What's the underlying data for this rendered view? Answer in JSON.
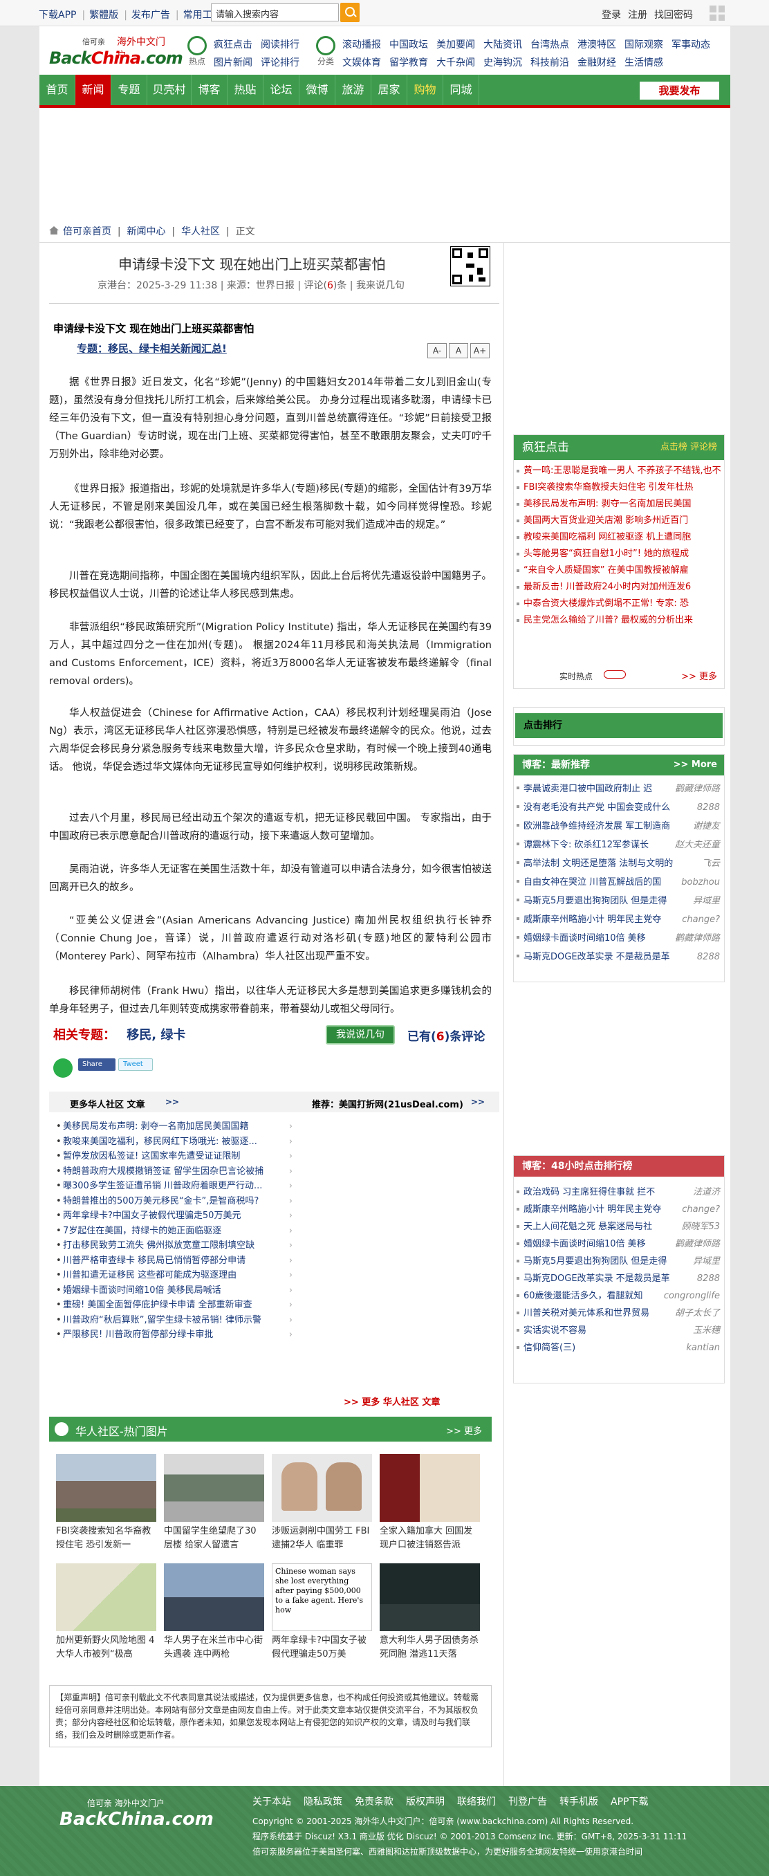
{
  "topbar": {
    "download": "下载APP",
    "trad": "繁體版",
    "ad": "发布广告",
    "tools": "常用工具",
    "search_placeholder": "请输入搜索内容",
    "login": "登录",
    "register": "注册",
    "forgot": "找回密码"
  },
  "logo": {
    "small": "倍可亲",
    "red": "海外中文门户",
    "big_pre": "Back",
    "big_mid": "China",
    "big_post": ".com"
  },
  "nav_hot": {
    "label": "热点",
    "row1": [
      "疯狂点击",
      "阅读排行"
    ],
    "row2": [
      "图片新闻",
      "评论排行"
    ]
  },
  "nav_cat": {
    "label": "分类",
    "row1": [
      "滚动播报",
      "中国政坛",
      "美加要闻",
      "大陆资讯",
      "台湾热点",
      "港澳特区",
      "国际观察",
      "军事动态"
    ],
    "row2": [
      "文娱体育",
      "留学教育",
      "大千杂闻",
      "史海钩沉",
      "科技前沿",
      "金融财经",
      "生活情感"
    ]
  },
  "mainnav": [
    "首页",
    "新闻",
    "专题",
    "贝壳村",
    "博客",
    "热贴",
    "论坛",
    "微博",
    "旅游",
    "居家",
    "购物",
    "同城"
  ],
  "publish": "我要发布",
  "crumb": [
    "倍可亲首页",
    "新闻中心",
    "华人社区",
    "正文"
  ],
  "article": {
    "title": "申请绿卡没下文 现在她出门上班买菜都害怕",
    "meta_source": "京港台：2025-3-29 11:38 | 来源：世界日报 | 评论(",
    "meta_count": "6",
    "meta_tail": ")条 | 我来说几句",
    "bold_title": "申请绿卡没下文 现在她出门上班买菜都害怕",
    "topic": "专题：移民、绿卡相关新闻汇总!",
    "font_btns": [
      "A-",
      "A",
      "A+"
    ],
    "paras": [
      "据《世界日报》近日发文，化名“珍妮”(Jenny) 的中国籍妇女2014年带着二女儿到旧金山(专题)，虽然没有身分但找托儿所打工机会，后来嫁给美公民。 办身分过程出现诸多耽溺，申请绿卡已经三年仍没有下文，但一直没有特别担心身分问题，直到川普总统赢得连任。“珍妮”日前接受卫报（The Guardian）专访时说，现在出门上班、买菜都觉得害怕，甚至不敢跟朋友聚会，丈夫叮咛千万别外出，除非绝对必要。",
      "《世界日报》报道指出，珍妮的处境就是许多华人(专题)移民(专题)的缩影，全国估计有39万华人无证移民，不管是刚来美国没几年，或在美国已经生根落脚数十载，如今同样觉得惶恐。珍妮说：“我跟老公都很害怕，很多政策已经变了，白宫不断发布可能对我们造成冲击的规定。”",
      "川普在竞选期间指称，中国企图在美国境内组织军队，因此上台后将优先遣返役龄中国籍男子。 移民权益倡议人士说，川普的论述让华人移民感到焦虑。",
      "非营派组织“移民政策研究所”(Migration Policy Institute) 指出，华人无证移民在美国约有39万人，其中超过四分之一住在加州(专题)。 根据2024年11月移民和海关执法局（Immigration and Customs Enforcement，ICE）资料，将近3万8000名华人无证客被发布最终递解令（final removal orders)。",
      "华人权益促进会（Chinese for Affirmative Action，CAA）移民权利计划经理吴雨泊（Jose Ng）表示，湾区无证移民华人社区弥漫恐惧感，特别是已经被发布最终递解令的民众。他说，过去六周华促会移民身分紧急服务专线来电数量大增，许多民众仓皇求助，有时候一个晚上接到40通电话。 他说，华促会透过华文媒体向无证移民宣导如何维护权利，说明移民政策新规。",
      "过去八个月里，移民局已经出动五个架次的遣返专机，把无证移民载回中国。 专家指出，由于中国政府已表示愿意配合川普政府的遣返行动，接下来遣返人数可望增加。",
      "吴雨泊说，许多华人无证客在美国生活数十年，却没有管道可以申请合法身分，如今很害怕被送回离开已久的故乡。",
      "“亚美公义促进会”(Asian Americans Advancing Justice) 南加州民权组织执行长钟乔（Connie Chung Joe，音译）说，川普政府遣返行动对洛杉矶(专题)地区的蒙特利公园市（Monterey Park）、阿罕布拉市（Alhambra）华人社区出现严重不安。",
      "移民律师胡树伟（Frank Hwu）指出，以往华人无证移民大多是想到美国追求更多赚钱机会的单身年轻男子，但过去几年则转变成携家带眷前来，带着婴幼儿或祖父母同行。"
    ],
    "related_label": "相关专题：",
    "related_links": [
      "移民",
      "绿卡"
    ],
    "say_btn": "我说说几句",
    "comment_pre": "已有(",
    "comment_count": "6",
    "comment_post": ")条评论",
    "share": {
      "wechat": "微信",
      "fb": "Share",
      "tw": "Tweet"
    }
  },
  "more_section": {
    "left_title": "更多华人社区 文章",
    "right_title": "推荐：美国打折网(21usDeal.com)",
    "items": [
      "美移民局发布声明: 剥夺一名南加居民美国国籍",
      "教唆来美国吃福利，移民网红下场哦光: 被驱逐...",
      "暂停发放因私签证! 这国家率先遭受证证限制",
      "特朗普政府大规模撤销签证 留学生因杂巴言论被捕",
      "曝300多学生签证遭吊销 川普政府着眼更严行动...",
      "特朗普推出的500万美元移民“金卡”,是智商税吗?",
      "两年拿绿卡?中国女子被假代理骗走50万美元",
      "7岁起住在美国，持绿卡的她正面临驱逐",
      "打击移民致劳工流失 佛州拟放宽童工限制填空缺",
      "川普严格审查绿卡 移民局已悄悄暂停部分申请",
      "川普扣遣无证移民 这些都可能成为驱逐理由",
      "婚姻绿卡面谈时间缩10倍 美移民局喊话",
      "重磅! 美国全面暂停庇护绿卡申请 全部重新审查",
      "川普政府“秋后算账”,留学生绿卡被吊销! 律师示警",
      "严限移民! 川普政府暂停部分绿卡审批"
    ],
    "more_link": ">> 更多 华人社区 文章"
  },
  "photos": {
    "title": "华人社区-热门图片",
    "more": ">> 更多",
    "items": [
      {
        "cap": "FBI突袭搜索知名华裔教授住宅 恐引发新一"
      },
      {
        "cap": "中国留学生绝望爬了30层楼 给家人留遗言"
      },
      {
        "cap": "涉贩运剥削中国劳工 FBI逮捕2华人 临重罪"
      },
      {
        "cap": "全家入籍加拿大 回国发现户口被注销怒告派"
      },
      {
        "cap": "加州更新野火风险地图 4大华人市被列“极高"
      },
      {
        "cap": "华人男子在米兰市中心街头遇袭 连中两枪"
      },
      {
        "cap": "两年拿绿卡?中国女子被假代理骗走50万美"
      },
      {
        "cap": "意大利华人男子因债务杀死同胞 潜逃11天落"
      }
    ],
    "img3_text": "Chinese woman says she lost everything after paying $500,000 to a fake agent. Here's how"
  },
  "disclaimer": "【郑重声明】倍可亲刊载此文不代表同意其说法或描述，仅为提供更多信息，也不构成任何投资或其他建议。转载需经倍可亲同意并注明出处。本网站有部分文章是由网友自由上传。对于此类文章本站仅提供交流平台，不为其版权负责；部分内容经社区和论坛转载，原作者未知，如果您发现本网站上有侵犯您的知识产权的文章，请及时与我们联络，我们会及时删除或更新作者。",
  "sidebar_hot": {
    "title": "疯狂点击",
    "tabs": [
      "点击榜",
      "评论榜"
    ],
    "items": [
      "黄一鸣:王思聪是我唯一男人 不养孩子不结钱,也不",
      "FBI突袭搜索华裔教授夫妇住宅 引发年杜热",
      "美移民局发布声明: 剥夺一名南加居民美国",
      "美国两大百货业迎关店潮 影响多州近百门",
      "教唆来美国吃福利 网红被驱逐 机上遭同胞",
      "头等舱男客“疯狂自慰1小时”! 她的旅程成",
      "“来自令人质疑国家” 在美中国教授被解雇",
      "最新反击! 川普政府24小时内对加州连发6",
      "中泰合资大楼爆炸式倒塌不正常! 专家: 恐",
      "民主党怎么输给了川普? 最权威的分析出来"
    ],
    "realtime": "实时热点",
    "more": ">> 更多"
  },
  "sidebar_rank": {
    "title": "点击排行"
  },
  "sidebar_blog": {
    "title": "博客：最新推荐",
    "more": ">> More",
    "items": [
      {
        "t": "李晨诚卖港口被中国政府制止 迟",
        "a": "鹳藏律师路"
      },
      {
        "t": "没有老毛没有共产党 中国会变成什么",
        "a": "8288"
      },
      {
        "t": "欧洲靠战争维持经济发展 军工制造商",
        "a": "谢捷友"
      },
      {
        "t": "谭震林下令: 砍杀红12军参谋长",
        "a": "赵大夫还童"
      },
      {
        "t": "高举法制 文明还是堕落 法制与文明的",
        "a": "飞云"
      },
      {
        "t": "自由女神在哭泣 川普瓦解战后的国",
        "a": "bobzhou"
      },
      {
        "t": "马斯克5月要退出狗狗团队 但是走得",
        "a": "异域里"
      },
      {
        "t": "威斯康辛州略施小计 明年民主党夺",
        "a": "change?"
      },
      {
        "t": "婚姻绿卡面谈时间缩10倍 美移",
        "a": "鹳藏律师路"
      },
      {
        "t": "马斯克DOGE改革实录 不是裁员是革",
        "a": "8288"
      }
    ]
  },
  "sidebar_48": {
    "title": "博客：48小时点击排行榜",
    "items": [
      {
        "t": "政治戏码 习主席狂得住事就 拦不",
        "a": "法道济"
      },
      {
        "t": "威斯康辛州略施小计 明年民主党夺",
        "a": "change?"
      },
      {
        "t": "天上人间花魁之死 悬案迷局与社",
        "a": "顾晓军53"
      },
      {
        "t": "婚姻绿卡面谈时间缩10倍 美移",
        "a": "鹳藏律师路"
      },
      {
        "t": "马斯克5月要退出狗狗团队 但是走得",
        "a": "异域里"
      },
      {
        "t": "马斯克DOGE改革实录 不是裁员是革",
        "a": "8288"
      },
      {
        "t": "60歲後還能活多久，看腿就知",
        "a": "congronglife"
      },
      {
        "t": "川普关税对美元体系和世界贸易",
        "a": "胡子太长了"
      },
      {
        "t": "实话实说不容易",
        "a": "玉米穗"
      },
      {
        "t": "信仰简答(三)",
        "a": "kantian"
      }
    ]
  },
  "footer": {
    "links": [
      "关于本站",
      "隐私政策",
      "免责条款",
      "版权声明",
      "联络我们",
      "刊登广告",
      "转手机版",
      "APP下载"
    ],
    "copyright": "Copyright © 2001-2025 海外华人中文门户：倍可亲 (www.backchina.com) All Rights Reserved.",
    "system": "程序系统基于 Discuz! X3.1 商业版 优化 Discuz! © 2001-2013 Comsenz Inc. 更新：GMT+8, 2025-3-31 11:11",
    "note": "倍可亲服务器位于美国圣何塞、西雅图和达拉斯顶级数据中心，为更好服务全球网友特统一使用京港台时间"
  },
  "colors": {
    "green": "#3e9b4d",
    "red": "#c00",
    "link": "#1a3a7a"
  }
}
